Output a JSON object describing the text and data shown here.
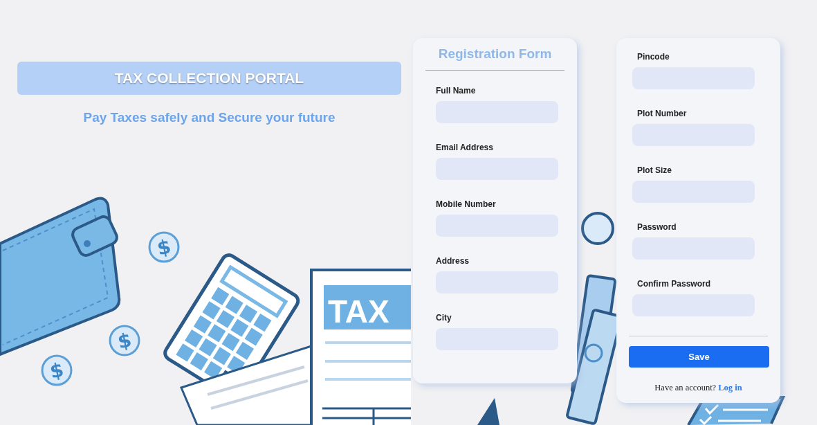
{
  "header": {
    "title": "TAX COLLECTION PORTAL",
    "tagline": "Pay Taxes safely and Secure your future"
  },
  "illustration": {
    "coins": [
      {
        "symbol": "$"
      },
      {
        "symbol": "$"
      },
      {
        "symbol": "$"
      }
    ],
    "document_label": "TAX"
  },
  "form_panels": [
    {
      "title": "Registration Form",
      "fields": [
        {
          "label": "Full Name"
        },
        {
          "label": "Email Address"
        },
        {
          "label": "Mobile Number"
        },
        {
          "label": "Address"
        },
        {
          "label": "City"
        }
      ]
    },
    {
      "fields": [
        {
          "label": "Pincode"
        },
        {
          "label": "Plot Number"
        },
        {
          "label": "Plot Size"
        },
        {
          "label": "Password"
        },
        {
          "label": "Confirm Password"
        }
      ],
      "submit_button": "Save",
      "footer": {
        "text": "Have an account?",
        "link": "Log in"
      }
    }
  ]
}
